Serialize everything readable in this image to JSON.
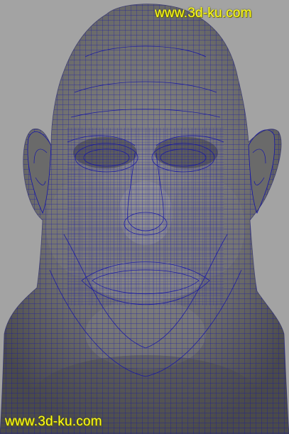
{
  "viewport": {
    "background": "#a3a3a3",
    "model": {
      "shade_color": "#6b6b6b",
      "wire_color": "#1414a8"
    }
  },
  "watermarks": {
    "top": "www.3d-ku.com",
    "bottom": "www.3d-ku.com",
    "color": "#ffff1a"
  }
}
